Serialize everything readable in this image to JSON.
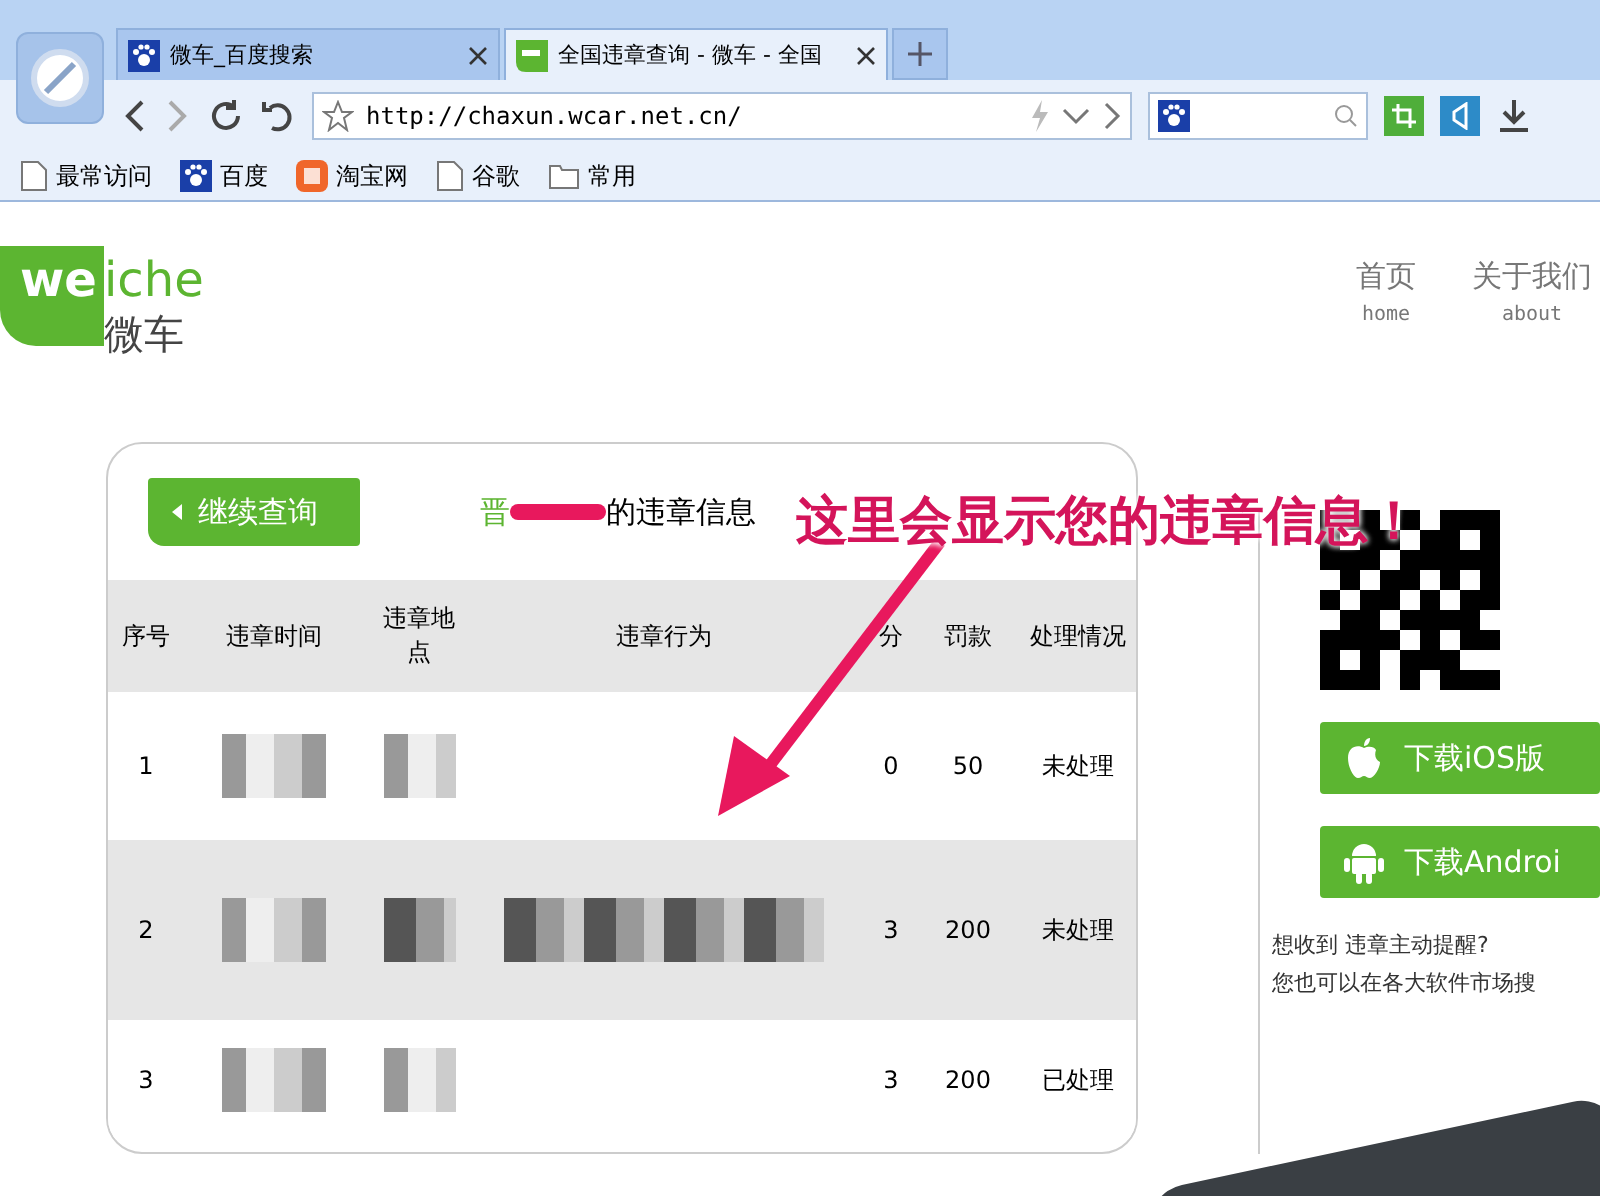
{
  "browser": {
    "tabs": [
      {
        "title": "微车_百度搜索",
        "kind": "paw",
        "selected": false
      },
      {
        "title": "全国违章查询 - 微车 - 全国",
        "kind": "we",
        "selected": true
      }
    ],
    "address": "http://chaxun.wcar.net.cn/",
    "bookmarks": [
      {
        "label": "最常访问",
        "kind": "page"
      },
      {
        "label": "百度",
        "kind": "paw"
      },
      {
        "label": "淘宝网",
        "kind": "taobao"
      },
      {
        "label": "谷歌",
        "kind": "page"
      },
      {
        "label": "常用",
        "kind": "folder"
      }
    ]
  },
  "site": {
    "logo": {
      "bold": "we",
      "light": "iche",
      "chinese": "微车"
    },
    "nav": [
      {
        "label": "首页",
        "sub": "home"
      },
      {
        "label": "关于我们",
        "sub": "about"
      }
    ]
  },
  "result": {
    "back_button": "继续查询",
    "plate_prefix": "晋",
    "title_suffix": "的违章信息",
    "columns": [
      "序号",
      "违章时间",
      "违章地点",
      "违章行为",
      "分",
      "罚款",
      "处理情况"
    ],
    "rows": [
      {
        "index": "1",
        "points": "0",
        "fine": "50",
        "status": "未处理"
      },
      {
        "index": "2",
        "points": "3",
        "fine": "200",
        "status": "未处理"
      },
      {
        "index": "3",
        "points": "3",
        "fine": "200",
        "status": "已处理"
      }
    ]
  },
  "app": {
    "downloads": [
      {
        "label": "下载iOS版",
        "kind": "apple"
      },
      {
        "label": "下载Androi",
        "kind": "android"
      }
    ],
    "reminder": "想收到 违章主动提醒?",
    "hint": "您也可以在各大软件市场搜"
  },
  "annotation": "这里会显示您的违章信息！"
}
